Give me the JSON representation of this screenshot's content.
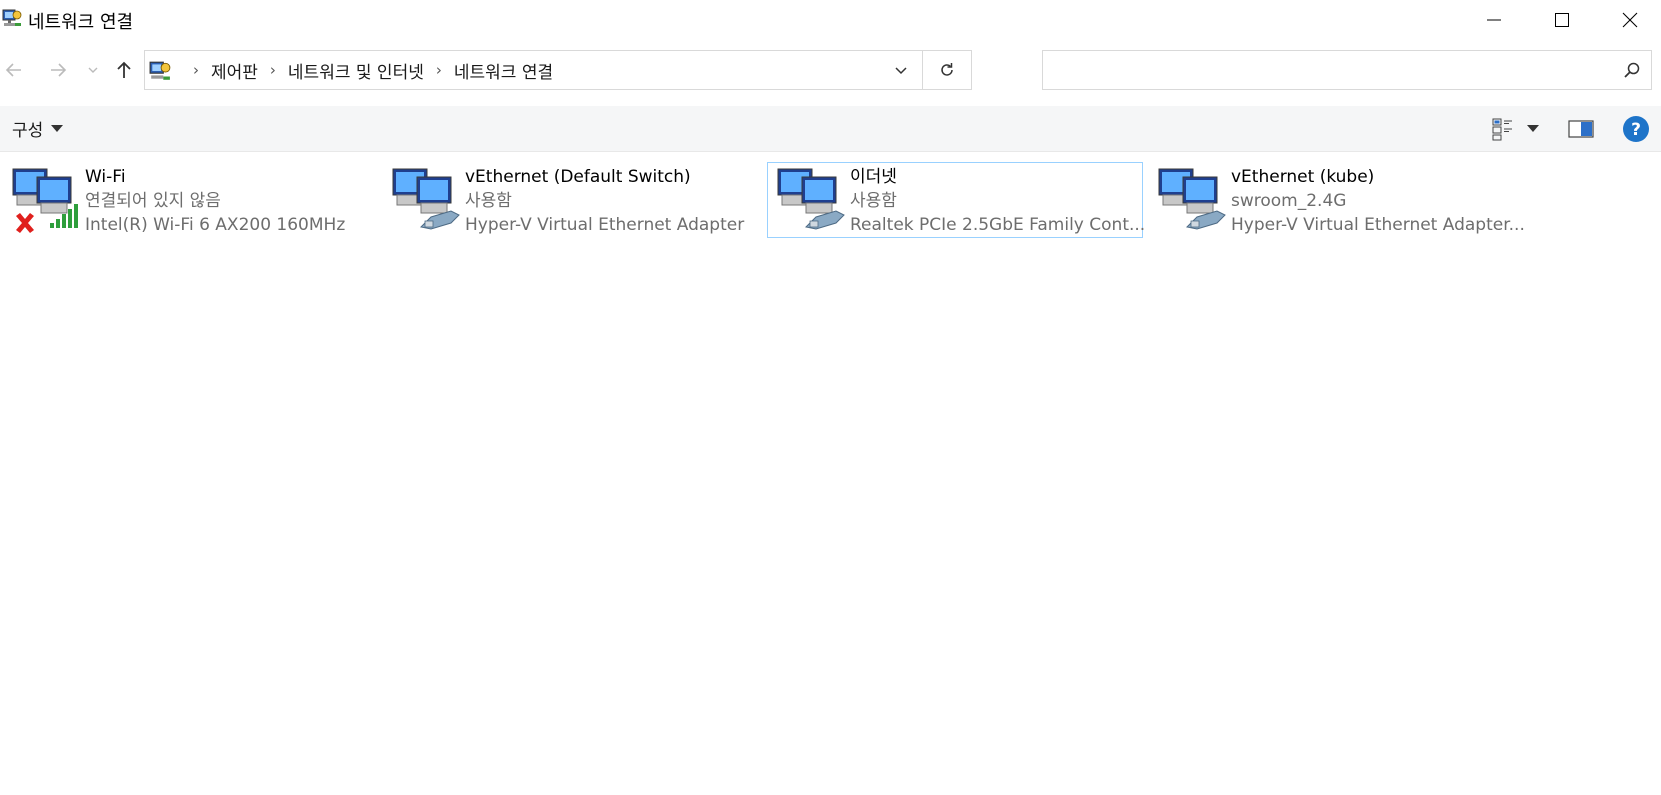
{
  "window": {
    "title": "네트워크 연결"
  },
  "nav": {
    "breadcrumbs": [
      "제어판",
      "네트워크 및 인터넷",
      "네트워크 연결"
    ],
    "search_placeholder": ""
  },
  "toolbar": {
    "organize_label": "구성"
  },
  "connections": [
    {
      "name": "Wi-Fi",
      "status": "연결되어 있지 않음",
      "device": "Intel(R) Wi-Fi 6 AX200 160MHz",
      "type": "wifi",
      "selected": false
    },
    {
      "name": "vEthernet (Default Switch)",
      "status": "사용함",
      "device": "Hyper-V Virtual Ethernet Adapter",
      "type": "ethernet",
      "selected": false
    },
    {
      "name": "이더넷",
      "status": "사용함",
      "device": "Realtek PCIe 2.5GbE Family Cont...",
      "type": "ethernet",
      "selected": true
    },
    {
      "name": "vEthernet (kube)",
      "status": "swroom_2.4G",
      "device": "Hyper-V Virtual Ethernet Adapter...",
      "type": "ethernet",
      "selected": false
    }
  ],
  "colors": {
    "selection_border": "#99d1ff",
    "help_blue": "#1e74c9",
    "error_red": "#e0201d",
    "signal_green": "#2e9e3c"
  }
}
